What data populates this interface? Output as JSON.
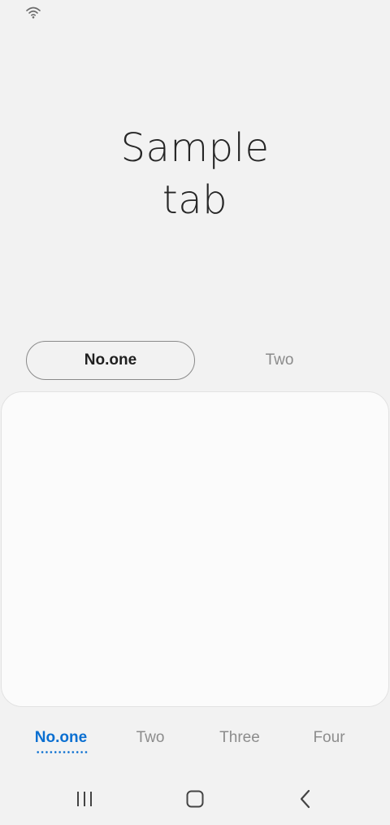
{
  "title": {
    "line1": "Sample",
    "line2": "tab"
  },
  "segmented_tabs": [
    {
      "label": "No.one",
      "selected": true
    },
    {
      "label": "Two",
      "selected": false
    }
  ],
  "bottom_tabs": [
    {
      "label": "No.one",
      "selected": true
    },
    {
      "label": "Two",
      "selected": false
    },
    {
      "label": "Three",
      "selected": false
    },
    {
      "label": "Four",
      "selected": false
    }
  ],
  "status_bar": {
    "icons": [
      "wifi-icon"
    ]
  },
  "navigation_bar": {
    "icons": [
      "recent-apps-icon",
      "home-icon",
      "back-icon"
    ]
  },
  "colors": {
    "background": "#f2f2f2",
    "accent": "#0a6fd1",
    "inactive_text": "#8c8c8c",
    "card_background": "#fbfbfb"
  }
}
